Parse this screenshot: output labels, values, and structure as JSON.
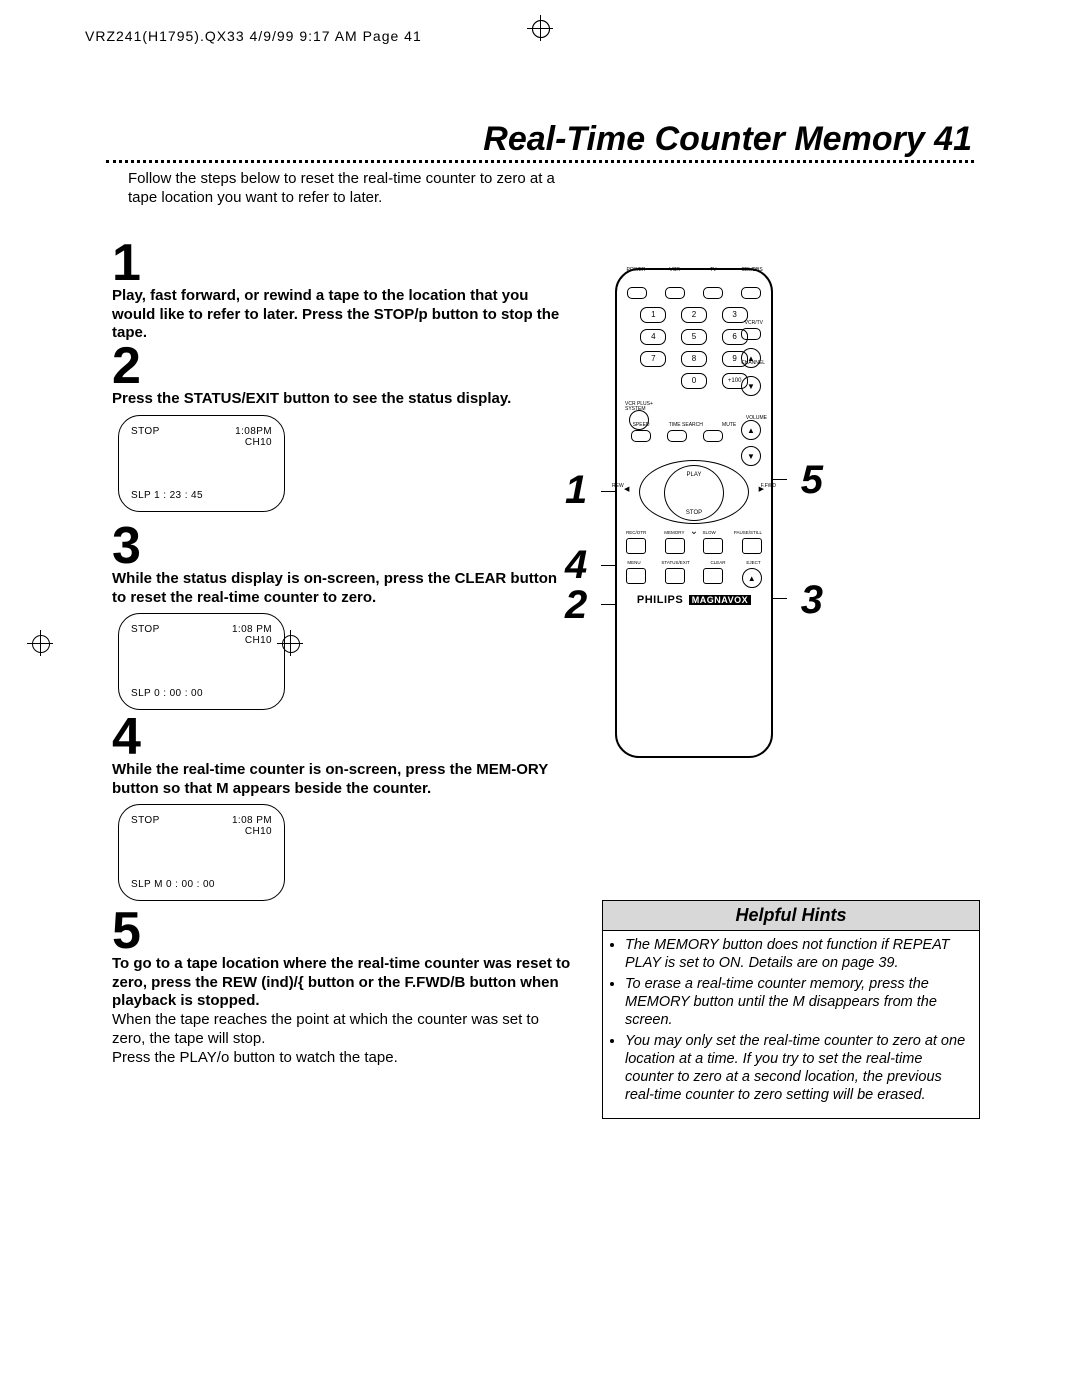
{
  "header": "VRZ241(H1795).QX33  4/9/99 9:17 AM  Page 41",
  "title": "Real-Time Counter Memory  41",
  "intro": "Follow the steps below to reset the real-time counter to zero at a tape location you want to refer to later.",
  "steps": {
    "s1": {
      "n": "1",
      "text": "Play, fast forward, or rewind a tape to the location that you would like to refer to later. Press the STOP/p  button to stop the tape."
    },
    "s2": {
      "n": "2",
      "text": "Press the STATUS/EXIT button to see the status display."
    },
    "s3": {
      "n": "3",
      "text": "While the status display is on-screen, press the CLEAR button to reset the real-time counter to zero."
    },
    "s4": {
      "n": "4",
      "text": "While the real-time counter is on-screen, press the MEM-ORY button so that M appears beside the counter."
    },
    "s5": {
      "n": "5",
      "text": "To go to a tape location where the real-time counter was reset to zero, press the REW (ind)/{  button or the F.FWD/B  button when playback is stopped.",
      "p1": "When the tape reaches the point at which the counter was set to zero, the tape will stop.",
      "p2": "Press the PLAY/o  button to watch the tape."
    }
  },
  "status2": {
    "tl": "STOP",
    "tr1": "1:08PM",
    "tr2": "CH10",
    "bl": "SLP       1 : 23 : 45"
  },
  "status3": {
    "tl": "STOP",
    "tr1": "1:08 PM",
    "tr2": "CH10",
    "bl": "SLP       0 : 00 : 00"
  },
  "status4": {
    "tl": "STOP",
    "tr1": "1:08 PM",
    "tr2": "CH10",
    "bl": "SLP    M   0 : 00 : 00"
  },
  "remote": {
    "topLabels": [
      "POWER",
      "VCR",
      "TV",
      "CBL/DBS"
    ],
    "vcrtv": "VCR/TV",
    "nums": [
      "1",
      "2",
      "3",
      "4",
      "5",
      "6",
      "7",
      "8",
      "9",
      "",
      "0",
      "+100"
    ],
    "channel": "CHANNEL",
    "vcrplus": "VCR PLUS+\\nSYSTEM",
    "midLabels": [
      "SPEED",
      "TIME SEARCH",
      "MUTE"
    ],
    "volume": "VOLUME",
    "play": "PLAY",
    "stop": "STOP",
    "rew": "REW",
    "fwd": "F.FWD",
    "recRow": [
      "REC/OTR",
      "MEMORY",
      "SLOW",
      "PAUSE/STILL"
    ],
    "menuRow": [
      "MENU",
      "STATUS/EXIT",
      "CLEAR",
      "EJECT"
    ],
    "brand1": "PHILIPS",
    "brand2": "MAGNAVOX"
  },
  "callouts": {
    "c1": "1",
    "c2": "2",
    "c3": "3",
    "c4": "4",
    "c5": "5"
  },
  "hints": {
    "title": "Helpful Hints",
    "h1": "The MEMORY button does not function if REPEAT PLAY is set to ON. Details are on page 39.",
    "h2": "To erase a real-time counter memory, press the MEMORY button until the M disappears from the screen.",
    "h3": "You may only set the real-time counter to zero at one location at a time. If you try to set the real-time counter to zero at a second location, the previous real-time counter to zero setting will be erased."
  }
}
